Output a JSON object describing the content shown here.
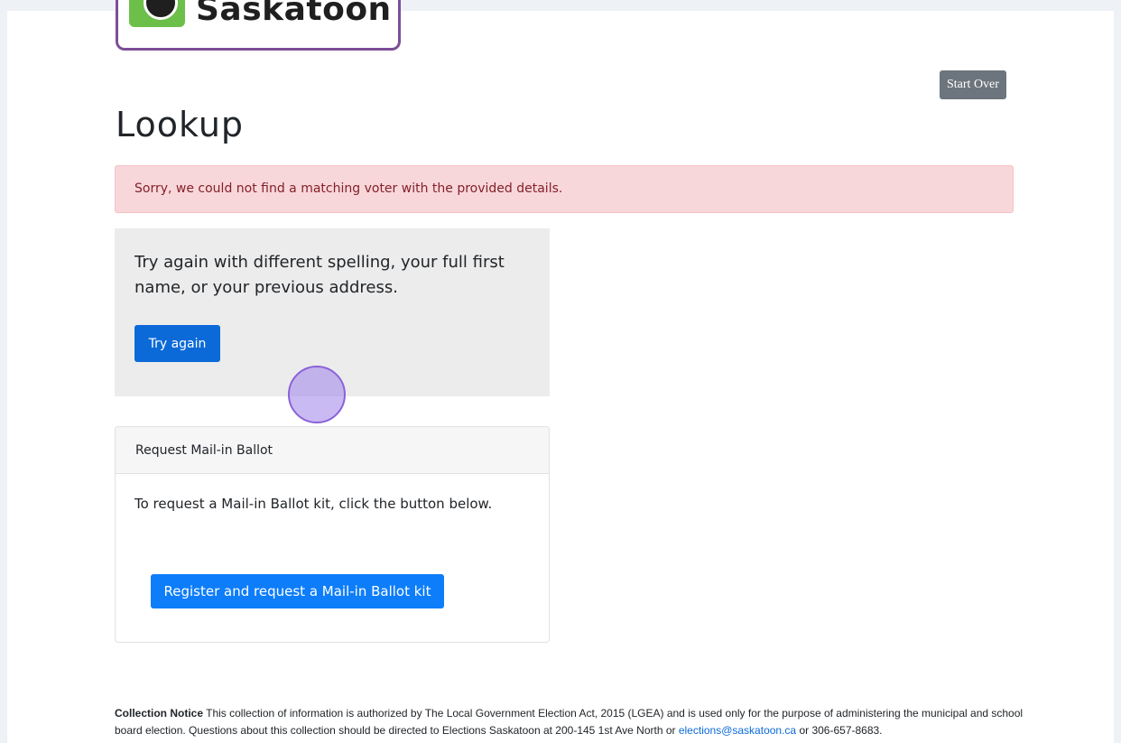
{
  "header": {
    "logo_text": "Saskatoon",
    "start_over_label": "Start Over"
  },
  "main": {
    "title": "Lookup",
    "alert_message": "Sorry, we could not find a matching voter with the provided details.",
    "retry_panel": {
      "text": "Try again with different spelling, your full first name, or your previous address.",
      "button_label": "Try again"
    },
    "mail_card": {
      "header": "Request Mail-in Ballot",
      "text": "To request a Mail-in Ballot kit, click the button below.",
      "button_label": "Register and request a Mail-in Ballot kit"
    }
  },
  "footer": {
    "notice_title": "Collection Notice",
    "notice_body": " This collection of information is authorized by The Local Government Election Act, 2015 (LGEA) and is used only for the purpose of administering the municipal and school board election. Questions about this collection should be directed to Elections Saskatoon at 200-145 1st Ave North or ",
    "email": "elections@saskatoon.ca",
    "notice_tail": " or 306-657-8683."
  },
  "colors": {
    "logo_border": "#7d4e97",
    "logo_green": "#6cc04a",
    "primary": "#0b6ad8",
    "secondary": "#6c757d",
    "alert_bg": "#f8d7da",
    "alert_text": "#842029"
  },
  "icons": {
    "logo_mark": "saskatoon-logo-icon",
    "cursor": "click-indicator"
  }
}
